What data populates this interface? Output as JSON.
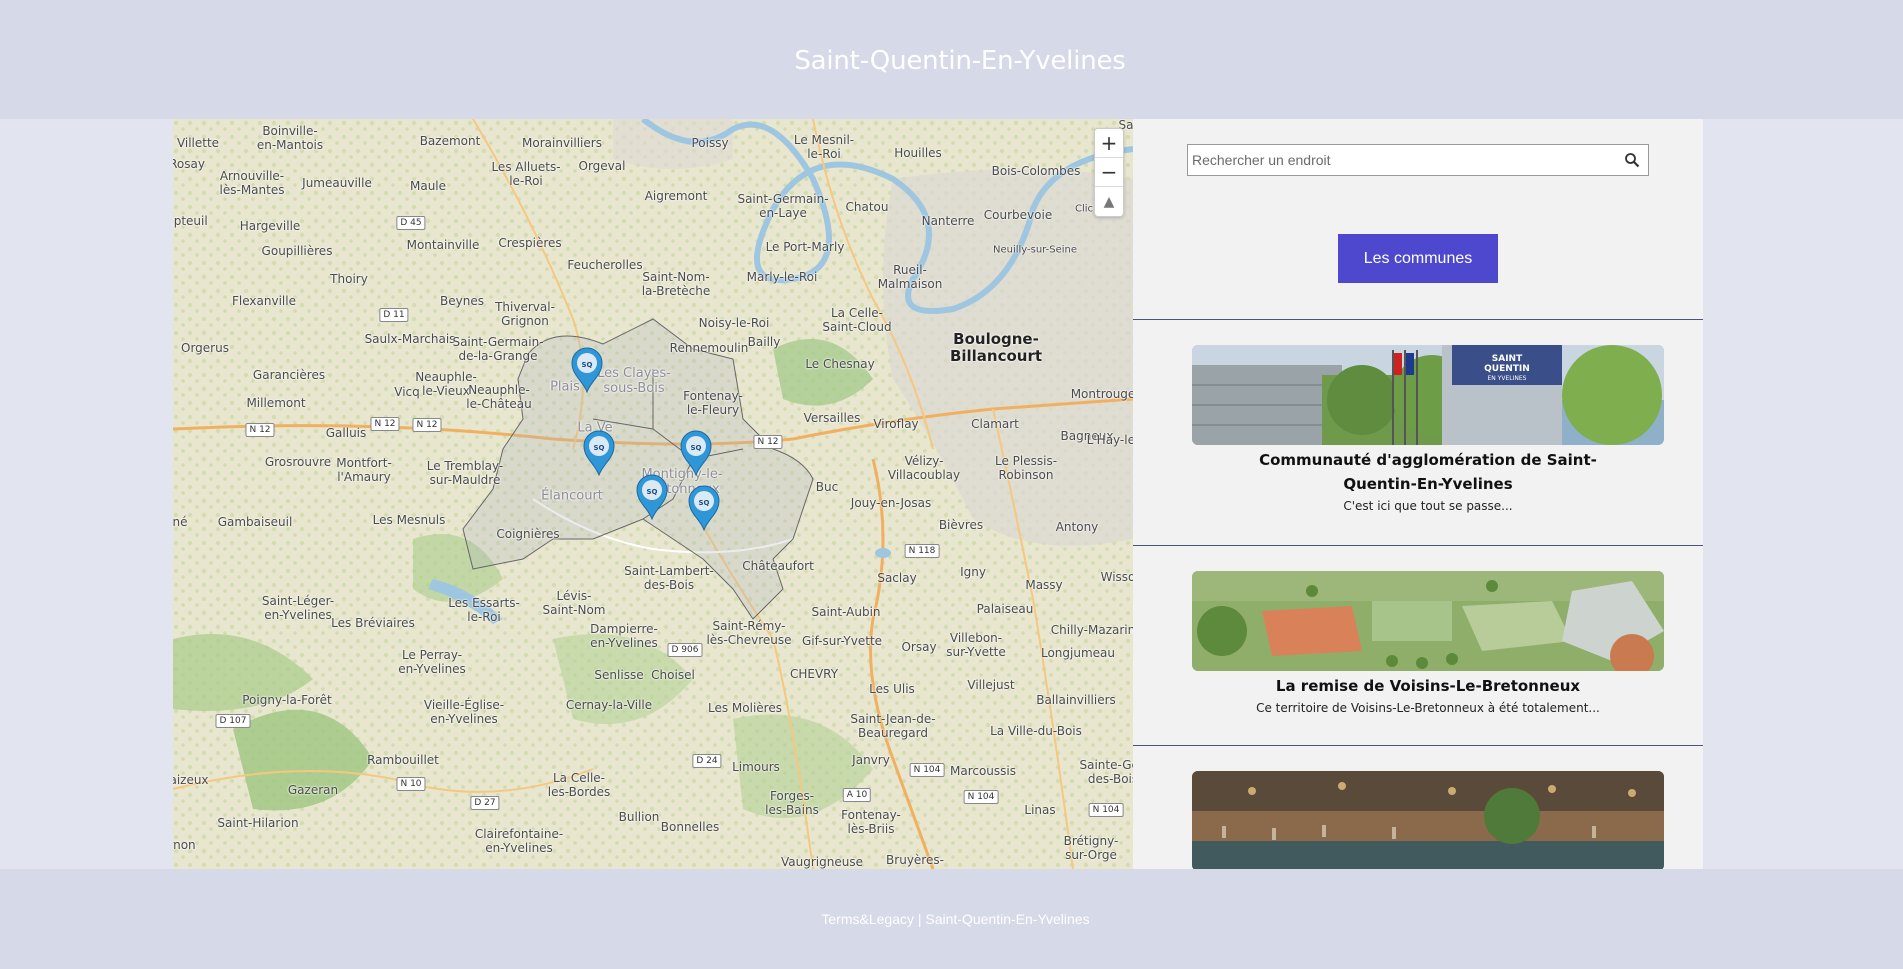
{
  "header": {
    "title": "Saint-Quentin-En-Yvelines"
  },
  "map": {
    "zoom_in_label": "+",
    "zoom_out_label": "−",
    "reset_label": "▲",
    "places": [
      {
        "t": "Boinville-\nen-Mantois"
      },
      {
        "t": "Villette"
      },
      {
        "t": "Bazemont"
      },
      {
        "t": "Morainvilliers"
      },
      {
        "t": "Poissy"
      },
      {
        "t": "Le Mesnil-\nle-Roi"
      },
      {
        "t": "Houilles"
      },
      {
        "t": "Bois-Colombes"
      },
      {
        "t": "Arnouville-\nlès-Mantes"
      },
      {
        "t": "Jumeauville"
      },
      {
        "t": "Maule"
      },
      {
        "t": "Les Alluets-\nle-Roi"
      },
      {
        "t": "Orgeval"
      },
      {
        "t": "Aigremont"
      },
      {
        "t": "Saint-Germain-\nen-Laye"
      },
      {
        "t": "Chatou"
      },
      {
        "t": "Nanterre"
      },
      {
        "t": "Courbevoie"
      },
      {
        "t": "Hargeville"
      },
      {
        "t": "Montainville"
      },
      {
        "t": "Crespières"
      },
      {
        "t": "Feucherolles"
      },
      {
        "t": "Le Port-Marly"
      },
      {
        "t": "Goupillières"
      },
      {
        "t": "Saint-Nom-\nla-Bretèche"
      },
      {
        "t": "Marly-le-Roi"
      },
      {
        "t": "Rueil-\nMalmaison"
      },
      {
        "t": "Thoiry"
      },
      {
        "t": "Flexanville"
      },
      {
        "t": "Beynes"
      },
      {
        "t": "Thiverval-\nGrignon"
      },
      {
        "t": "La Celle-\nSaint-Cloud"
      },
      {
        "t": "Boulogne-\nBillancourt"
      },
      {
        "t": "Saulx-Marchais"
      },
      {
        "t": "Saint-Germain-\nde-la-Grange"
      },
      {
        "t": "Noisy-le-Roi"
      },
      {
        "t": "Bailly"
      },
      {
        "t": "Rennemoulin"
      },
      {
        "t": "Le Chesnay"
      },
      {
        "t": "Orgerus"
      },
      {
        "t": "Garancières"
      },
      {
        "t": "Neauphle-\nle-Vieux"
      },
      {
        "t": "Vicq"
      },
      {
        "t": "Neauphle-\nle-Château"
      },
      {
        "t": "Millemont"
      },
      {
        "t": "Fontenay-\nle-Fleury"
      },
      {
        "t": "Versailles"
      },
      {
        "t": "Viroflay"
      },
      {
        "t": "Montrouge"
      },
      {
        "t": "Galluis"
      },
      {
        "t": "Clamart"
      },
      {
        "t": "Bagneux"
      },
      {
        "t": "Grosrouvre"
      },
      {
        "t": "Montfort-\nl'Amaury"
      },
      {
        "t": "Le Tremblay-\nsur-Mauldre"
      },
      {
        "t": "Vélizy-\nVillacoublay"
      },
      {
        "t": "Le Plessis-\nRobinson"
      },
      {
        "t": "L'Hay-le-"
      },
      {
        "t": "Buc"
      },
      {
        "t": "Jouy-en-Josas"
      },
      {
        "t": "Gambaiseuil"
      },
      {
        "t": "Les Mesnuls"
      },
      {
        "t": "Bièvres"
      },
      {
        "t": "Antony"
      },
      {
        "t": "Saint-Lambert-\ndes-Bois"
      },
      {
        "t": "Châteaufort"
      },
      {
        "t": "Igny"
      },
      {
        "t": "Massy"
      },
      {
        "t": "Saclay"
      },
      {
        "t": "Saint-Léger-\nen-Yvelines"
      },
      {
        "t": "Lévis-\nSaint-Nom"
      },
      {
        "t": "Les Essarts-\nle-Roi"
      },
      {
        "t": "Palaiseau"
      },
      {
        "t": "Chilly-Mazarin"
      },
      {
        "t": "Saint-Aubin"
      },
      {
        "t": "Les Bréviaires"
      },
      {
        "t": "Dampierre-\nen-Yvelines"
      },
      {
        "t": "Saint-Rémy-\nlès-Chevreuse"
      },
      {
        "t": "Gif-sur-Yvette"
      },
      {
        "t": "Orsay"
      },
      {
        "t": "Villebon-\nsur-Yvette"
      },
      {
        "t": "Longjumeau"
      },
      {
        "t": "Le Perray-\nen-Yvelines"
      },
      {
        "t": "Senlisse"
      },
      {
        "t": "Choisel"
      },
      {
        "t": "CHEVRY"
      },
      {
        "t": "Villejust"
      },
      {
        "t": "Poigny-la-Forêt"
      },
      {
        "t": "Vieille-Église-\nen-Yvelines"
      },
      {
        "t": "Cernay-la-Ville"
      },
      {
        "t": "Les Molières"
      },
      {
        "t": "Les Ulis"
      },
      {
        "t": "Ballainvilliers"
      },
      {
        "t": "Saint-Jean-de-\nBeauregard"
      },
      {
        "t": "La Ville-du-Bois"
      },
      {
        "t": "Rambouillet"
      },
      {
        "t": "Janvry"
      },
      {
        "t": "Marcoussis"
      },
      {
        "t": "Sainte-Gen\ndes-Bois"
      },
      {
        "t": "Limours"
      },
      {
        "t": "Gazeran"
      },
      {
        "t": "La Celle-\nles-Bordes"
      },
      {
        "t": "Forges-\nles-Bains"
      },
      {
        "t": "Linas"
      },
      {
        "t": "Fontenay-\nlès-Briis"
      },
      {
        "t": "Saint-Hilarion"
      },
      {
        "t": "Bullion"
      },
      {
        "t": "Bonnelles"
      },
      {
        "t": "Brétigny-\nsur-Orge"
      },
      {
        "t": "Clairefontaine-\nen-Yvelines"
      },
      {
        "t": "Vaugrigneuse"
      },
      {
        "t": "Bruyères-"
      },
      {
        "t": "Neuilly-sur-Seine"
      },
      {
        "t": "Clic"
      },
      {
        "t": "Wisso"
      },
      {
        "t": "Rosay"
      },
      {
        "t": "epteuil"
      },
      {
        "t": "Plais"
      },
      {
        "t": "Les Clayes-\nsous-Bois"
      },
      {
        "t": "Élancourt"
      },
      {
        "t": "Coignières"
      },
      {
        "t": "Montigny-le-\nBretonneux"
      },
      {
        "t": "La Ve"
      },
      {
        "t": "né"
      },
      {
        "t": "aizeux"
      },
      {
        "t": "rnon"
      },
      {
        "t": "Sa"
      }
    ],
    "roads": [
      "D 45",
      "D 11",
      "N 12",
      "N 12",
      "N 12",
      "N 12",
      "N 118",
      "D 906",
      "D 107",
      "D 24",
      "N 10",
      "D 27",
      "N 104",
      "A 10",
      "N 104",
      "N 104"
    ]
  },
  "sidebar": {
    "search_placeholder": "Rechercher un endroit",
    "communes_button": "Les communes",
    "cards": [
      {
        "title": "Communauté d'agglomération de Saint-Quentin-En-Yvelines",
        "desc": "C'est ici que tout se passe...",
        "image_text": "SAINT QUENTIN EN YVELINES"
      },
      {
        "title": "La remise de Voisins-Le-Bretonneux",
        "desc": "Ce territoire de Voisins-Le-Bretonneux à été totalement..."
      },
      {
        "title": "",
        "desc": ""
      }
    ]
  },
  "footer": {
    "text": "Terms&Legacy  |  Saint-Quentin-En-Yvelines"
  },
  "colors": {
    "header_bg": "#d5d9e8",
    "button": "#4e48cf",
    "pin": "#2f97d8",
    "divider": "#4b5578"
  }
}
